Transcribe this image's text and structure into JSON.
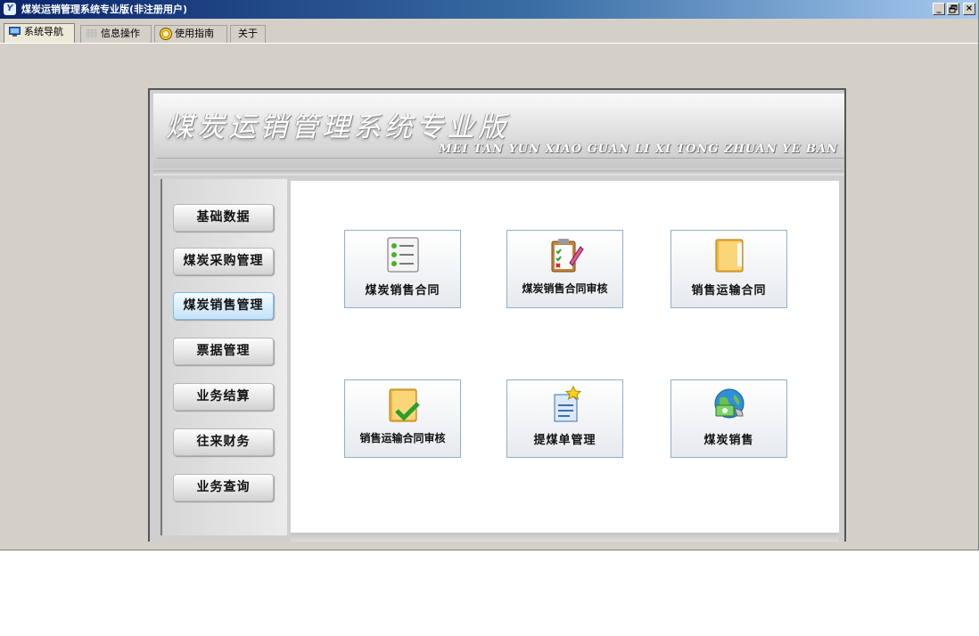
{
  "window": {
    "title": "煤炭运销管理系统专业版(非注册用户)",
    "title_logo": "Y"
  },
  "window_controls": {
    "minimize": "_",
    "restore": "🗗",
    "close": "×"
  },
  "tabs": [
    {
      "label": "系统导航",
      "icon": "monitor-icon",
      "active": true
    },
    {
      "label": "信息操作",
      "icon": "grid-icon",
      "active": false
    },
    {
      "label": "使用指南",
      "icon": "smiley-icon",
      "active": false
    },
    {
      "label": "关于",
      "icon": "",
      "active": false
    }
  ],
  "banner": {
    "title": "煤炭运销管理系统专业版",
    "subtitle": "MEI TAN YUN XIAO GUAN LI XI TONG ZHUAN YE BAN"
  },
  "sidebar": {
    "items": [
      {
        "label": "基础数据",
        "active": false
      },
      {
        "label": "煤炭采购管理",
        "active": false
      },
      {
        "label": "煤炭销售管理",
        "active": true
      },
      {
        "label": "票据管理",
        "active": false
      },
      {
        "label": "业务结算",
        "active": false
      },
      {
        "label": "往来财务",
        "active": false
      },
      {
        "label": "业务查询",
        "active": false
      }
    ]
  },
  "tiles": [
    {
      "label": "煤炭销售合同",
      "icon": "list-icon"
    },
    {
      "label": "煤炭销售合同审核",
      "icon": "clipboard-check-icon"
    },
    {
      "label": "销售运输合同",
      "icon": "folder-icon"
    },
    {
      "label": "销售运输合同审核",
      "icon": "folder-check-icon"
    },
    {
      "label": "提煤单管理",
      "icon": "document-star-icon"
    },
    {
      "label": "煤炭销售",
      "icon": "globe-cash-icon"
    }
  ],
  "colors": {
    "titlebar_start": "#0a246a",
    "titlebar_end": "#a6caf0",
    "active_nav": "#d6ecfb",
    "tile_border": "#8fb0c6"
  }
}
